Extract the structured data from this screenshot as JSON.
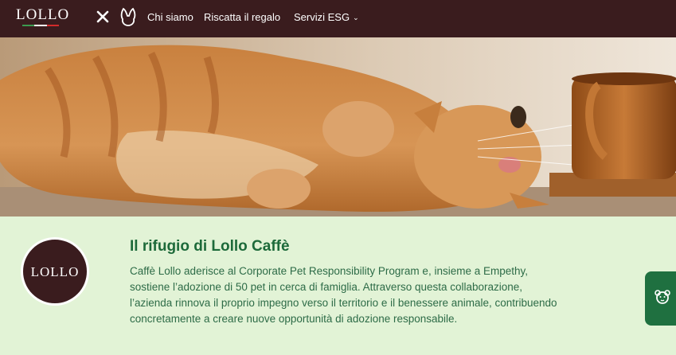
{
  "header": {
    "logo_text": "LOLLO",
    "nav": [
      {
        "label": "Chi siamo"
      },
      {
        "label": "Riscatta il regalo"
      },
      {
        "label": "Servizi ESG"
      }
    ]
  },
  "hero": {
    "image": "cat-with-coffee-cup-photo"
  },
  "section": {
    "badge_text": "LOLLO",
    "title": "Il rifugio di Lollo Caffè",
    "paragraph": "Caffè Lollo aderisce al Corporate Pet Responsibility Program e, insieme a Empethy, sostiene l’adozione di 50 pet in cerca di famiglia. Attraverso questa collaborazione, l’azienda rinnova il proprio impegno verso il territorio e il benessere animale, contribuendo concretamente a creare nuove opportunità di adozione responsabile."
  },
  "colors": {
    "header_bg": "#3a1c1e",
    "page_bg": "#e2f3d6",
    "title": "#1d6a3a",
    "text": "#2d6b47",
    "fab": "#1f7040"
  },
  "icons": [
    "close-x-icon",
    "bunny-logo-icon",
    "chevron-down-icon",
    "pet-face-icon"
  ]
}
